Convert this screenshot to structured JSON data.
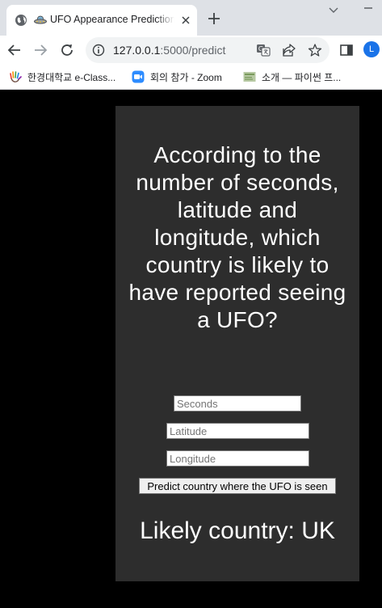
{
  "browser": {
    "tab": {
      "title": "UFO Appearance Prediction",
      "favicon": "ufo-icon"
    },
    "url": {
      "host": "127.0.0.1",
      "path": ":5000/predict"
    },
    "profile_initial": "L",
    "bookmarks": [
      {
        "label": "한경대학교 e-Class...",
        "icon": "hand-logo-icon"
      },
      {
        "label": "회의 참가 - Zoom",
        "icon": "zoom-icon"
      },
      {
        "label": "소개 — 파이썬 프...",
        "icon": "python-docs-icon"
      }
    ]
  },
  "page": {
    "heading": "According to the number of seconds, latitude and longitude, which country is likely to have reported seeing a UFO?",
    "form": {
      "seconds_placeholder": "Seconds",
      "latitude_placeholder": "Latitude",
      "longitude_placeholder": "Longitude",
      "submit_label": "Predict country where the UFO is seen"
    },
    "result": "Likely country: UK"
  },
  "colors": {
    "page_background": "#000000",
    "card_background": "#2d2d2d",
    "text": "#ffffff",
    "profile": "#1a73e8"
  }
}
